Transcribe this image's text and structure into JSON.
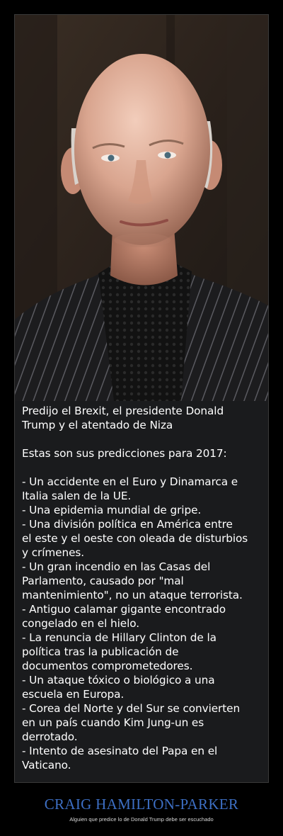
{
  "intro": {
    "line1": "Predijo el Brexit, el presidente Donald",
    "line2": "Trump y el atentado de Niza"
  },
  "subtitle": "Estas son sus predicciones para 2017:",
  "predictions": [
    [
      "- Un accidente en el Euro y Dinamarca e",
      "Italia salen de la UE."
    ],
    [
      "- Una epidemia mundial de gripe."
    ],
    [
      "- Una división política en América entre",
      "el este y el oeste con oleada de disturbios",
      "y crímenes."
    ],
    [
      "- Un gran incendio en las Casas del",
      "Parlamento, causado por \"mal",
      "mantenimiento\", no un ataque terrorista."
    ],
    [
      "- Antiguo calamar gigante encontrado",
      "congelado en el hielo."
    ],
    [
      "- La renuncia de Hillary Clinton de la",
      "política tras la publicación de",
      "documentos comprometedores."
    ],
    [
      "- Un ataque tóxico o biológico a una",
      "escuela en Europa."
    ],
    [
      "- Corea del Norte y del Sur se convierten",
      "en un país cuando Kim Jung-un es",
      "derrotado."
    ],
    [
      "- Intento de asesinato del Papa en el",
      "Vaticano."
    ]
  ],
  "title": "CRAIG HAMILTON-PARKER",
  "caption": "Alguien que predice lo de Donald Trump debe ser escuchado",
  "colors": {
    "title": "#3d6fc4",
    "panel": "#1a1b1d",
    "background": "#000000"
  }
}
